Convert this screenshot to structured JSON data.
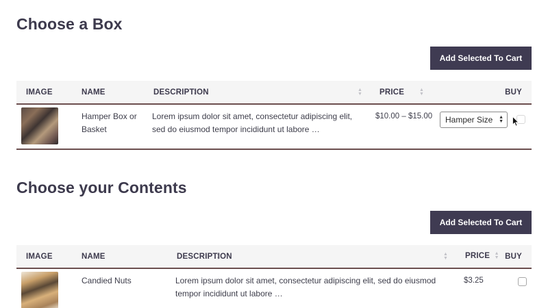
{
  "box_section": {
    "title": "Choose a Box",
    "add_button": "Add Selected To Cart",
    "columns": {
      "image": "IMAGE",
      "name": "NAME",
      "description": "DESCRIPTION",
      "price": "PRICE",
      "buy": "BUY"
    },
    "rows": [
      {
        "image_icon": "hamper-thumbnail",
        "name": "Hamper Box or Basket",
        "description": "Lorem ipsum dolor sit amet, consectetur adipiscing elit, sed do eiusmod tempor incididunt ut labore …",
        "price": "$10.00 – $15.00",
        "select_value": "Hamper Size"
      }
    ]
  },
  "contents_section": {
    "title": "Choose your Contents",
    "add_button": "Add Selected To Cart",
    "columns": {
      "image": "IMAGE",
      "name": "NAME",
      "description": "DESCRIPTION",
      "price": "PRICE",
      "buy": "BUY"
    },
    "rows": [
      {
        "image_icon": "nuts-thumbnail",
        "name": "Candied Nuts",
        "description": "Lorem ipsum dolor sit amet, consectetur adipiscing elit, sed do eiusmod tempor incididunt ut labore …",
        "price": "$3.25"
      }
    ]
  },
  "colors": {
    "button_bg": "#3f3b52",
    "row_border": "#6b4e4e",
    "header_bg": "#f5f5f5",
    "heading": "#3d3a4d"
  }
}
